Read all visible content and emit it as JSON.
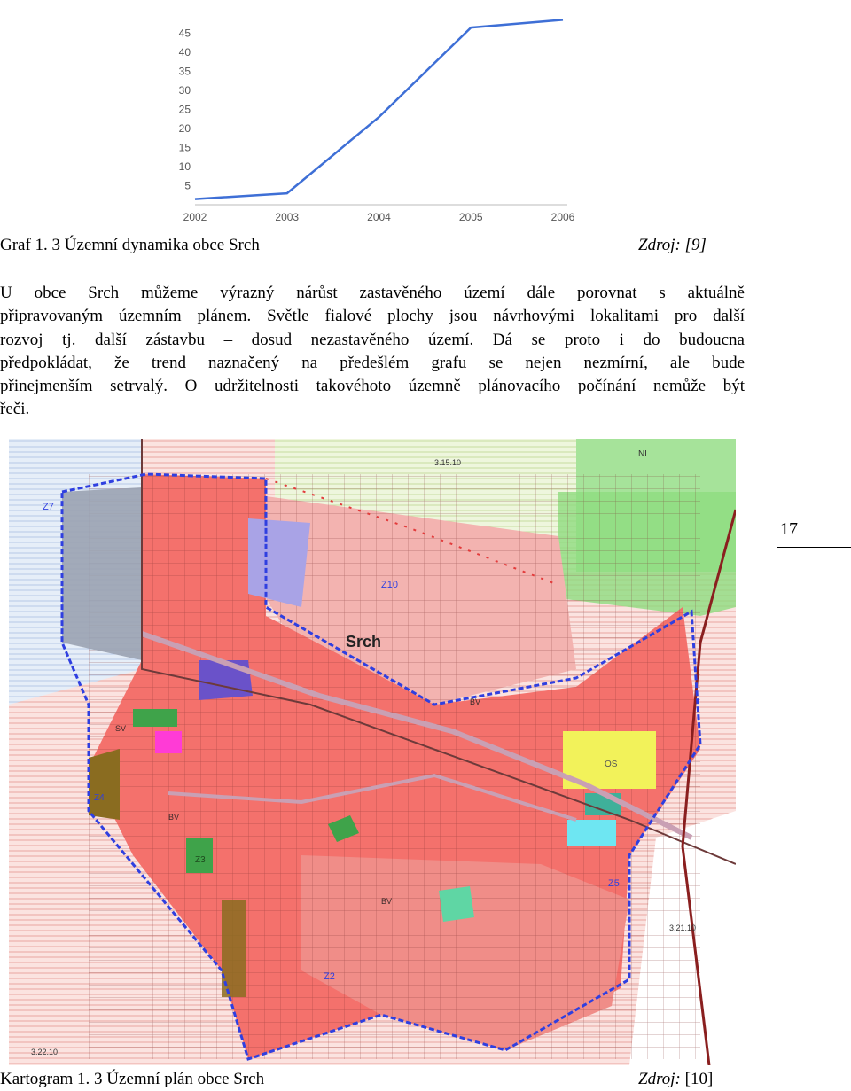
{
  "chart_data": {
    "type": "line",
    "x": [
      "2002",
      "2003",
      "2004",
      "2005",
      "2006"
    ],
    "series": [
      {
        "values": [
          1.5,
          3,
          23,
          46.5,
          48.5
        ]
      }
    ],
    "ylim": [
      0,
      50
    ],
    "yticks": [
      5,
      10,
      15,
      20,
      25,
      30,
      35,
      40,
      45
    ],
    "grid": false,
    "line_color": "#3e6fd6"
  },
  "graph_caption": {
    "label": "Graf 1. 3 Územní dynamika obce Srch",
    "source_label": "Zdroj:",
    "source_ref": "[9]"
  },
  "paragraph": [
    "U obce Srch můžeme výrazný nárůst zastavěného území dále porovnat s aktuálně",
    "připravovaným územním plánem. Světle fialové plochy jsou návrhovými lokalitami pro další",
    "rozvoj tj. další zástavbu – dosud nezastavěného území. Dá se proto i do budoucna",
    "předpokládat, že trend naznačený na předešlém grafu se nejen nezmírní, ale bude",
    "přinejmenším setrvalý. O udržitelnosti takovéhoto územně plánovacího počínání nemůže být",
    "řeči."
  ],
  "page_number": "17",
  "map": {
    "town_label": "Srch",
    "zone_labels": [
      "Z7",
      "Z10",
      "Z5",
      "Z2",
      "Z3",
      "Z4",
      "OS",
      "NL",
      "BV",
      "BV",
      "BV",
      "SV",
      "3.21.10",
      "3.22.10",
      "3.15.10"
    ]
  },
  "map_caption": {
    "label": "Kartogram 1. 3 Územní plán obce Srch",
    "source_label": "Zdroj:",
    "source_ref": "[10]"
  }
}
